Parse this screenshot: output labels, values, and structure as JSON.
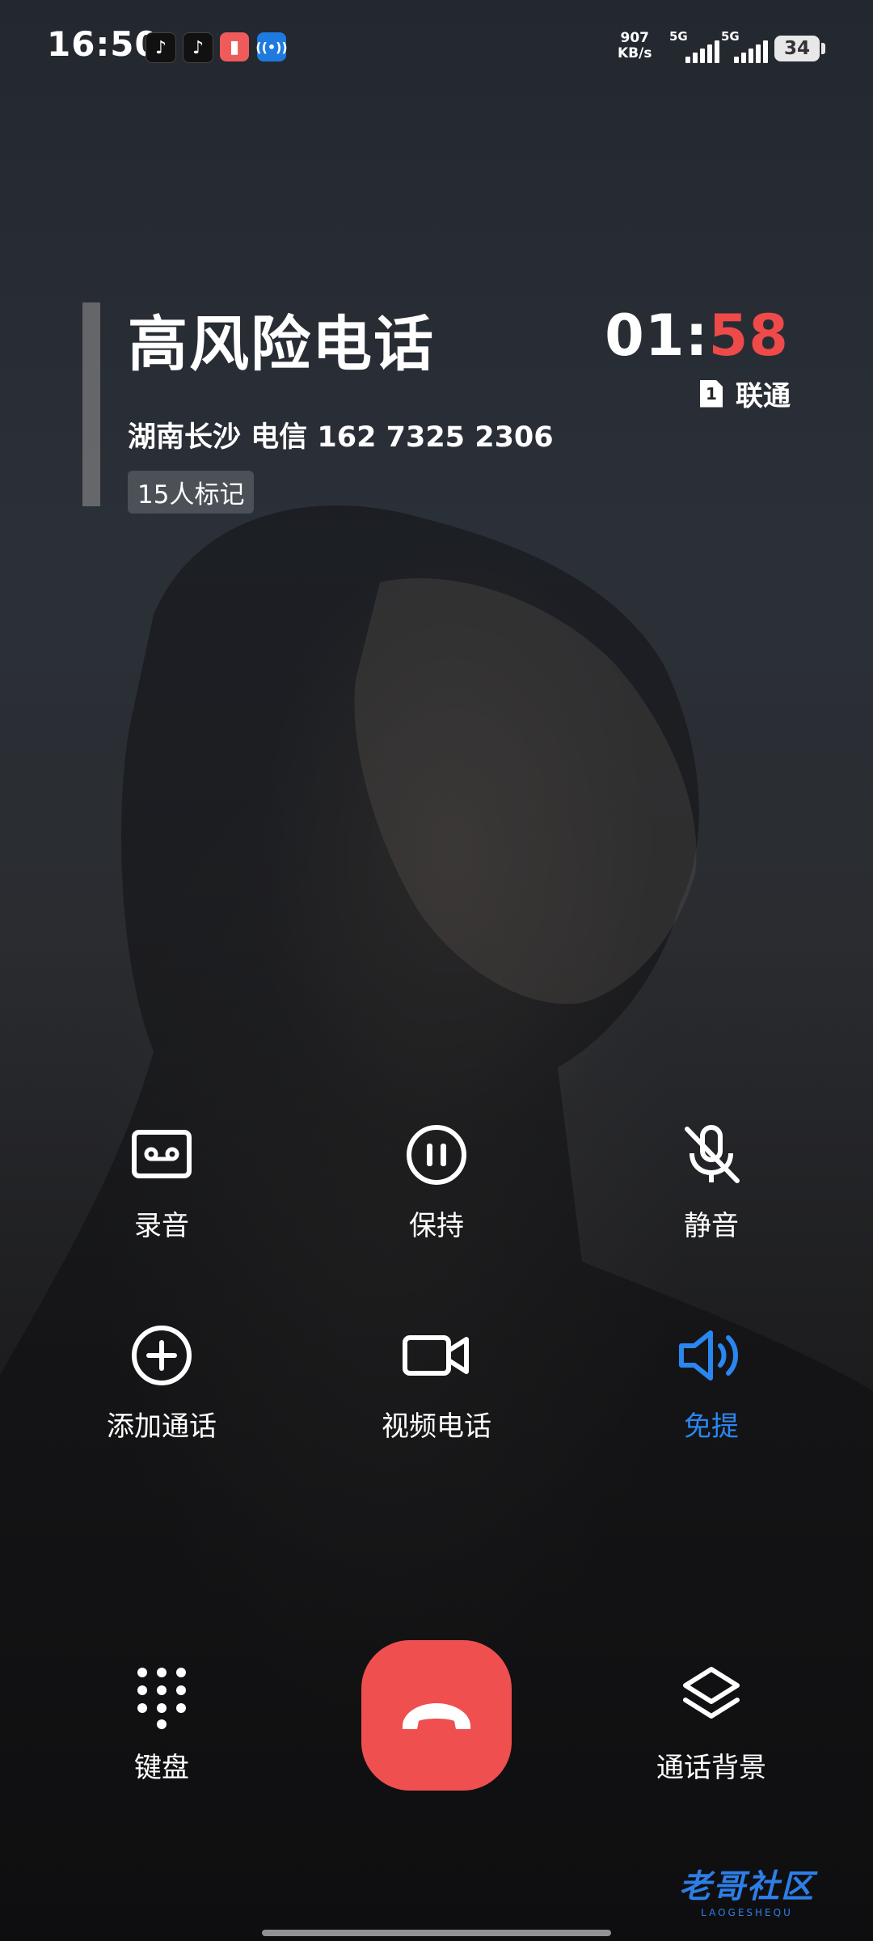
{
  "status_bar": {
    "time": "16:50",
    "apps": [
      {
        "icon": "tiktok-icon",
        "glyph": "♪"
      },
      {
        "icon": "tiktok-icon",
        "glyph": "♪"
      },
      {
        "icon": "red-app-icon",
        "glyph": "▮"
      },
      {
        "icon": "hotspot-icon",
        "glyph": "((•))"
      }
    ],
    "net_speed_value": "907",
    "net_speed_unit": "KB/s",
    "signal_1_label": "5G",
    "signal_2_label": "5G",
    "battery": "34"
  },
  "caller": {
    "name": "高风险电话",
    "detail": "湖南长沙  电信  162 7325 2306",
    "tag": "15人标记",
    "timer_minutes": "01:",
    "timer_seconds": "58",
    "sim_slot": "1",
    "carrier": "联通"
  },
  "controls": {
    "record": "录音",
    "hold": "保持",
    "mute": "静音",
    "add_call": "添加通话",
    "video_call": "视频电话",
    "speaker": "免提",
    "keypad": "键盘",
    "call_background": "通话背景"
  },
  "speaker_active": true,
  "colors": {
    "accent_blue": "#2a86f0",
    "end_call_red": "#ef4f4f",
    "timer_seconds_red": "#ee4a4a"
  },
  "watermark": {
    "main": "老哥社区",
    "sub": "LAOGESHEQU"
  }
}
